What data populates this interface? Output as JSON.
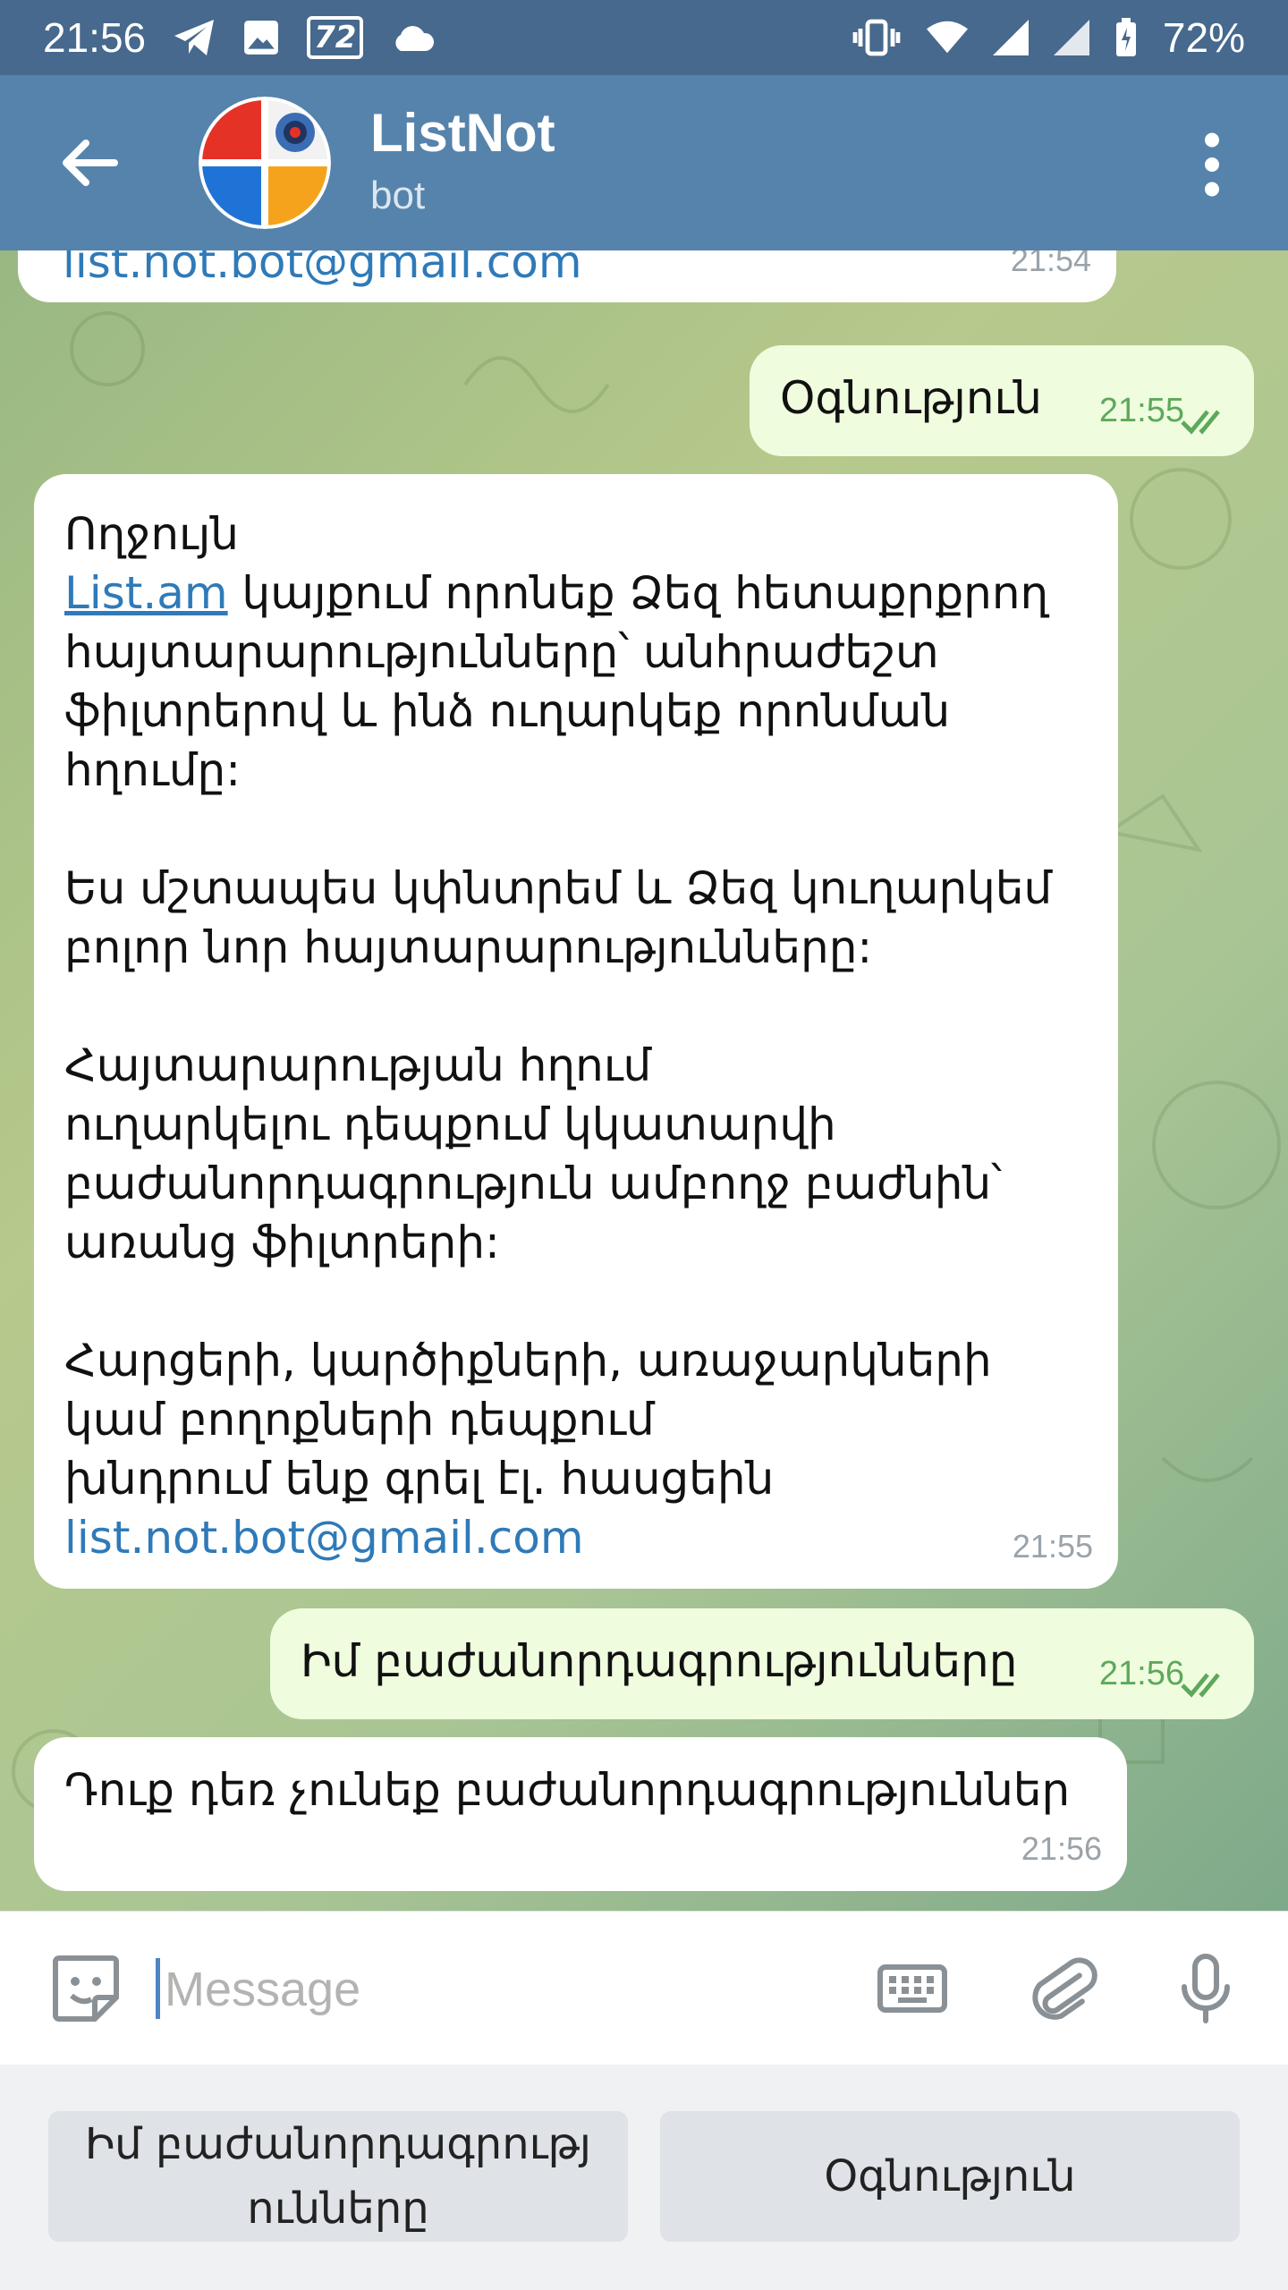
{
  "status_bar": {
    "time": "21:56",
    "notif_badge": "72",
    "battery": "72%"
  },
  "header": {
    "title": "ListNot",
    "subtitle": "bot"
  },
  "messages": [
    {
      "dir": "in",
      "text": "list.not.bot@gmail.com",
      "time": "21:54"
    },
    {
      "dir": "out",
      "text": "Օգնություն",
      "time": "21:55"
    },
    {
      "dir": "in",
      "line1": "Ողջույն",
      "link": "List.am",
      "body": " կայքում որոնեք Ձեզ հետաքրքրող\nհայտարարությունները՝ անհրաժեշտ\nֆիլտրերով և ինձ ուղարկեք որոնման\nհղումը:\n\nԵս մշտապես կփնտրեմ և Ձեզ կուղարկեմ\nբոլոր նոր հայտարարությունները:\n\nՀայտարարության հղում\nուղարկելու դեպքում կկատարվի\nբաժանորդագրություն ամբողջ բաժնին՝\nառանց ֆիլտրերի:\n\nՀարցերի, կարծիքների, առաջարկների\nկամ բողոքների դեպքում\nխնդրում ենք գրել էլ. հասցեին",
      "email": "list.not.bot@gmail.com",
      "time": "21:55"
    },
    {
      "dir": "out",
      "text": "Իմ բաժանորդագրությունները",
      "time": "21:56"
    },
    {
      "dir": "in",
      "text": "Դուք դեռ չունեք բաժանորդագրություններ",
      "time": "21:56"
    }
  ],
  "composer": {
    "placeholder": "Message"
  },
  "keyboard": {
    "button1": "Իմ բաժանորդագրությ\nունները",
    "button2": "Օգնություն"
  },
  "colors": {
    "status_bar": "#46698d",
    "header": "#5683ab",
    "outgoing_bubble": "#effdde",
    "incoming_bubble": "#ffffff",
    "link": "#2f7ab8",
    "read_check": "#5ea85c"
  },
  "icons": {
    "status_left": [
      "telegram-icon",
      "image-icon",
      "badge-icon",
      "cloud-icon"
    ],
    "status_right": [
      "vibrate-icon",
      "wifi-icon",
      "signal-icon",
      "signal-icon",
      "battery-charging-icon"
    ],
    "header": [
      "back-arrow-icon",
      "more-vert-icon"
    ],
    "composer": [
      "sticker-icon",
      "keyboard-icon",
      "attach-icon",
      "mic-icon"
    ]
  }
}
